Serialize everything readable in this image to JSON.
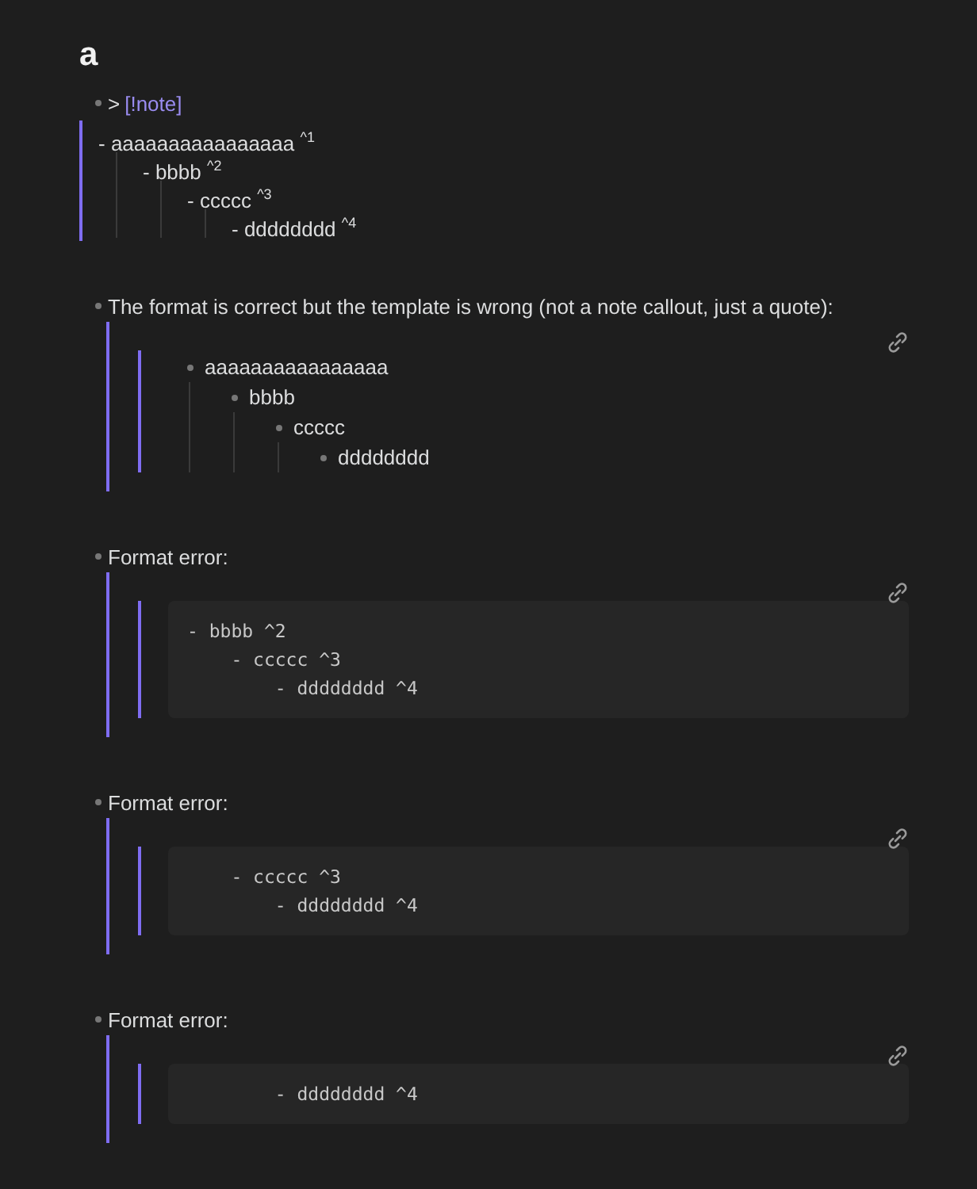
{
  "heading": "a",
  "blocks": [
    {
      "kind": "callout",
      "marker": ">",
      "tag": "[!note]",
      "lines": [
        {
          "text": "- aaaaaaaaaaaaaaaa $^{^1}$",
          "children": [
            {
              "text": "- bbbb $^{^2}$",
              "children": [
                {
                  "text": "- ccccc $^{^3}$",
                  "children": [
                    {
                      "text": "- dddddddd $^{^4}$"
                    }
                  ]
                }
              ]
            }
          ]
        }
      ]
    },
    {
      "kind": "list",
      "title": "The format is correct but the template is wrong (not a note callout, just a quote):",
      "items": [
        {
          "text": "aaaaaaaaaaaaaaaa",
          "children": [
            {
              "text": "bbbb",
              "children": [
                {
                  "text": "ccccc",
                  "children": [
                    {
                      "text": "dddddddd"
                    }
                  ]
                }
              ]
            }
          ]
        }
      ]
    },
    {
      "kind": "code",
      "title": "Format error:",
      "code": [
        "- bbbb ^2",
        "    - ccccc ^3",
        "        - dddddddd ^4"
      ]
    },
    {
      "kind": "code",
      "title": "Format error:",
      "code": [
        "    - ccccc ^3",
        "        - dddddddd ^4"
      ]
    },
    {
      "kind": "code",
      "title": "Format error:",
      "code": [
        "        - dddddddd ^4"
      ]
    }
  ]
}
